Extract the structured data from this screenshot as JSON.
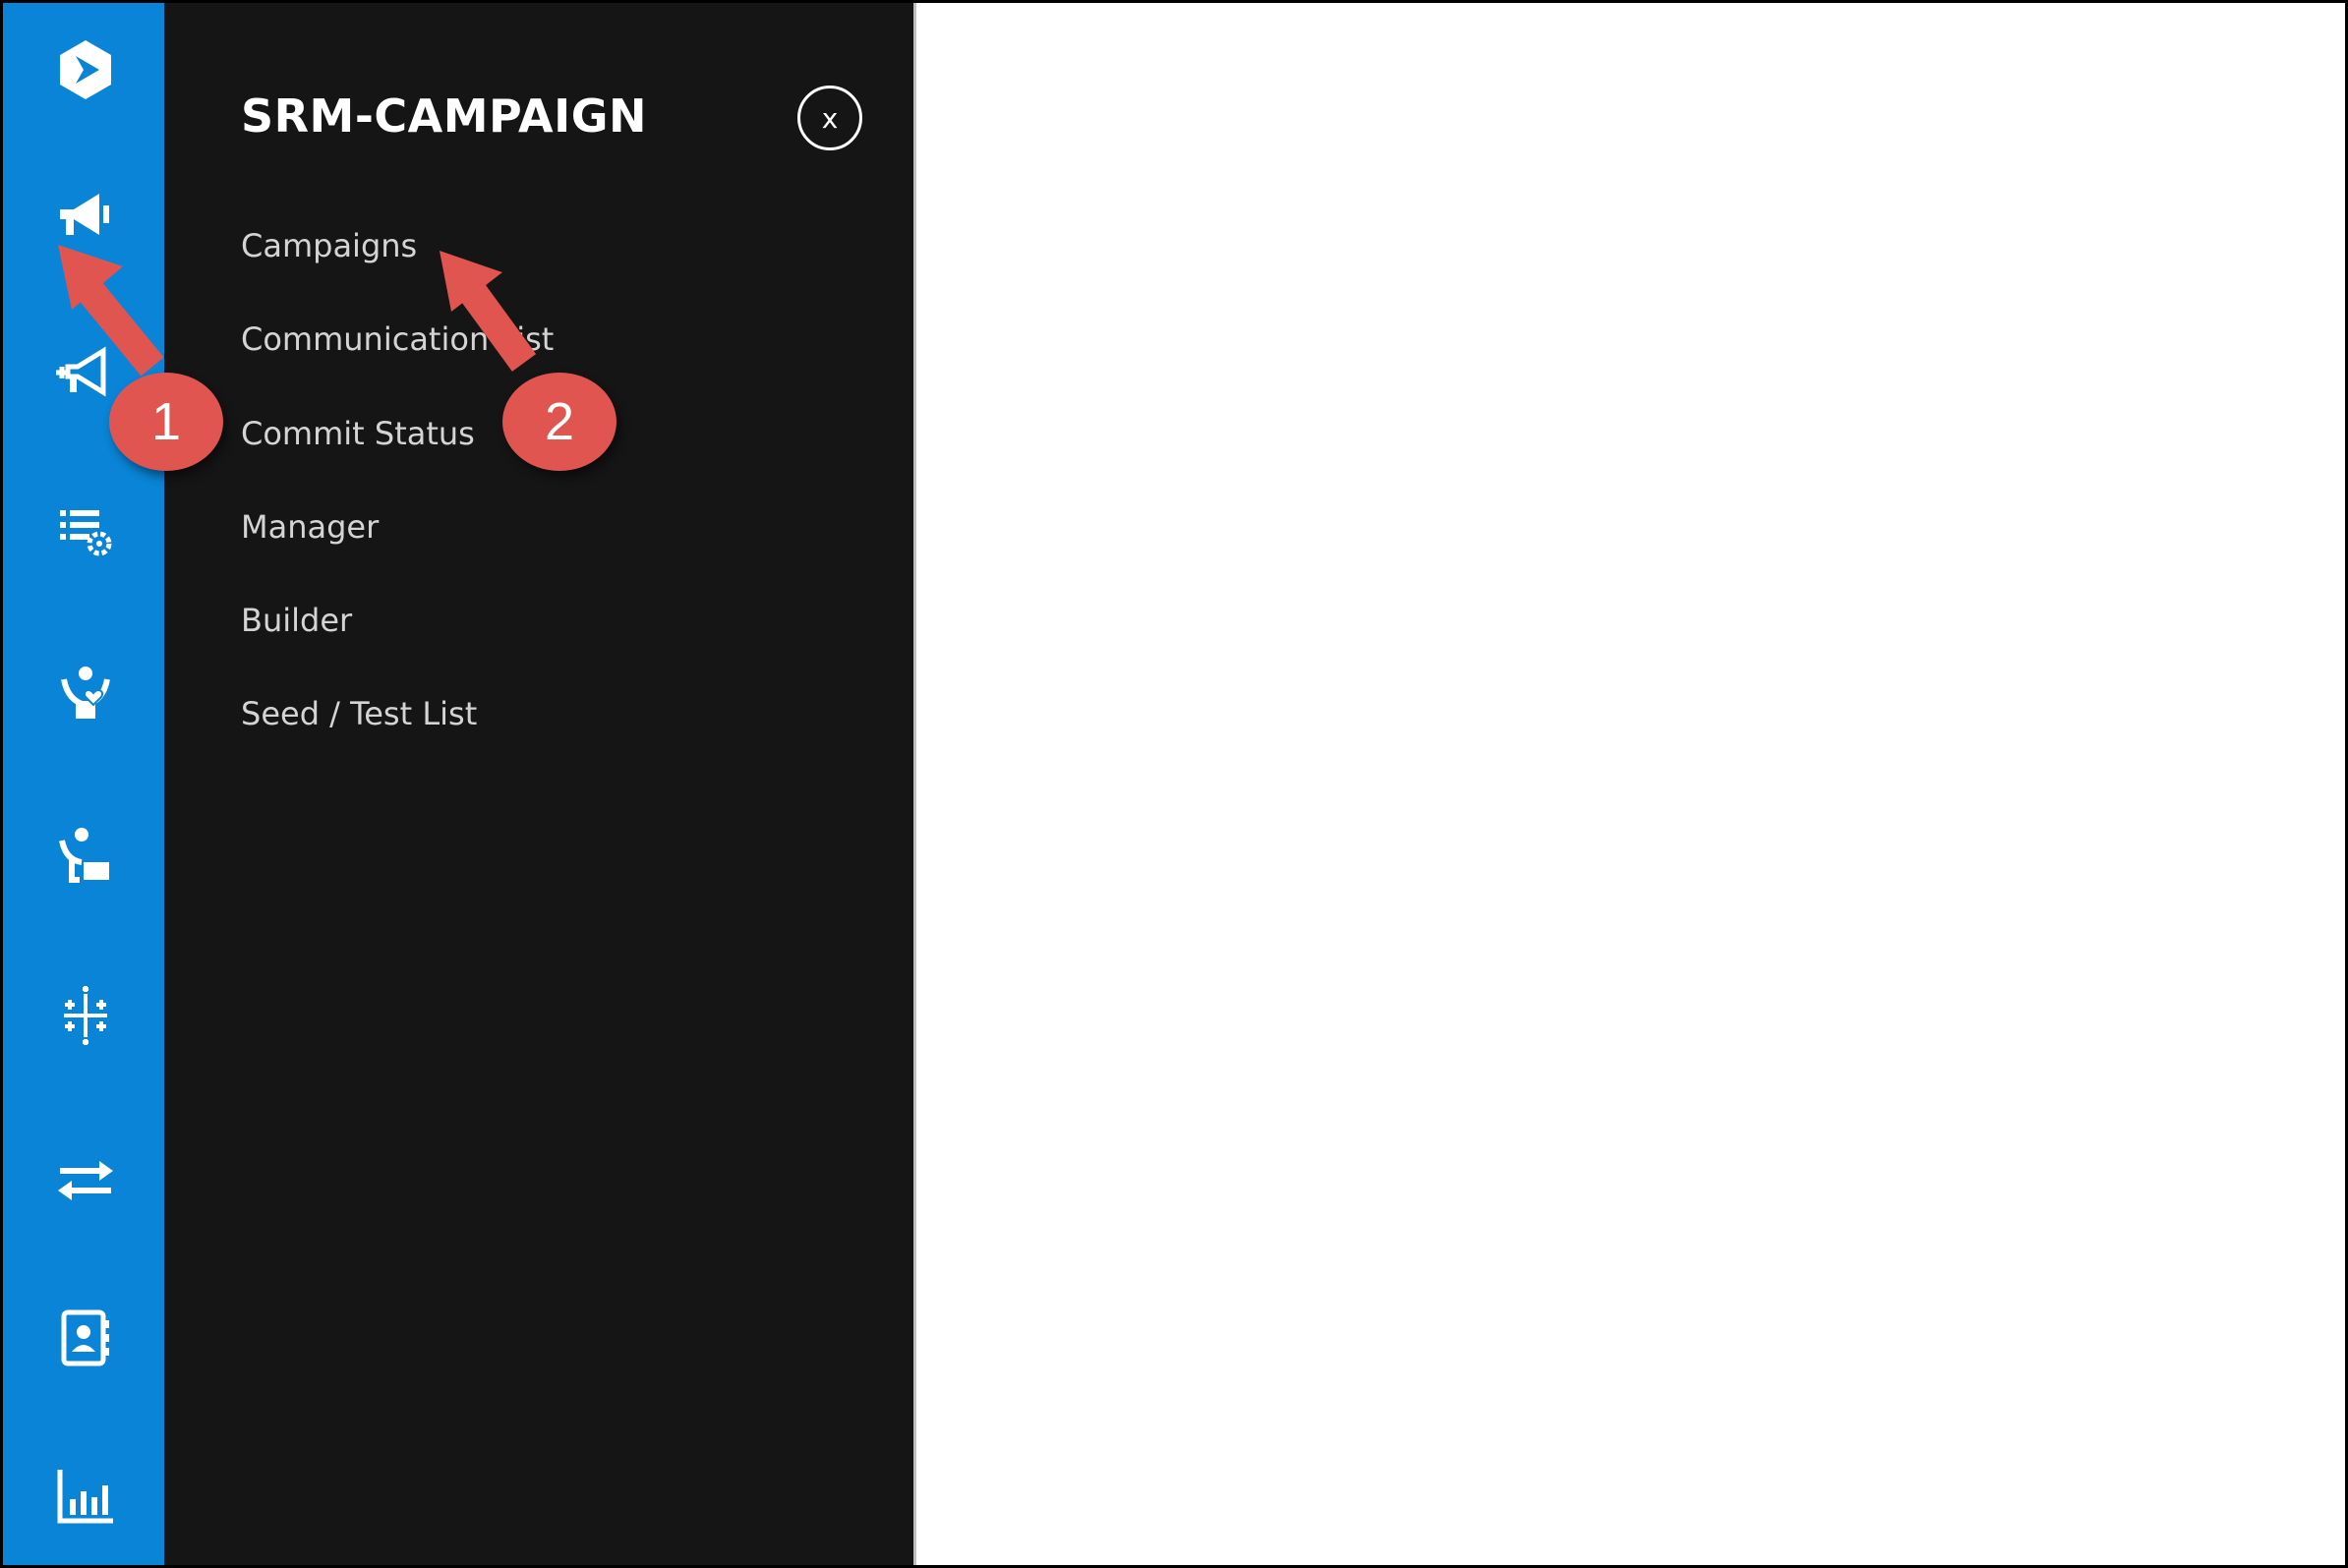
{
  "panel": {
    "title": "SRM-CAMPAIGN",
    "close_label": "x",
    "menu_items": [
      {
        "label": "Campaigns"
      },
      {
        "label": "Communication List"
      },
      {
        "label": "Commit Status"
      },
      {
        "label": "Manager"
      },
      {
        "label": "Builder"
      },
      {
        "label": "Seed / Test List"
      }
    ]
  },
  "rail": {
    "icons": [
      "logo-icon",
      "megaphone-icon",
      "megaphone-plus-icon",
      "list-settings-icon",
      "donor-heart-icon",
      "volunteer-icon",
      "tableau-icon",
      "transfer-icon",
      "contacts-icon",
      "reports-chart-icon"
    ]
  },
  "annotations": {
    "callout_1": "1",
    "callout_2": "2"
  },
  "colors": {
    "rail": "#0a84d6",
    "panel": "#151515",
    "callout": "#e05550"
  }
}
